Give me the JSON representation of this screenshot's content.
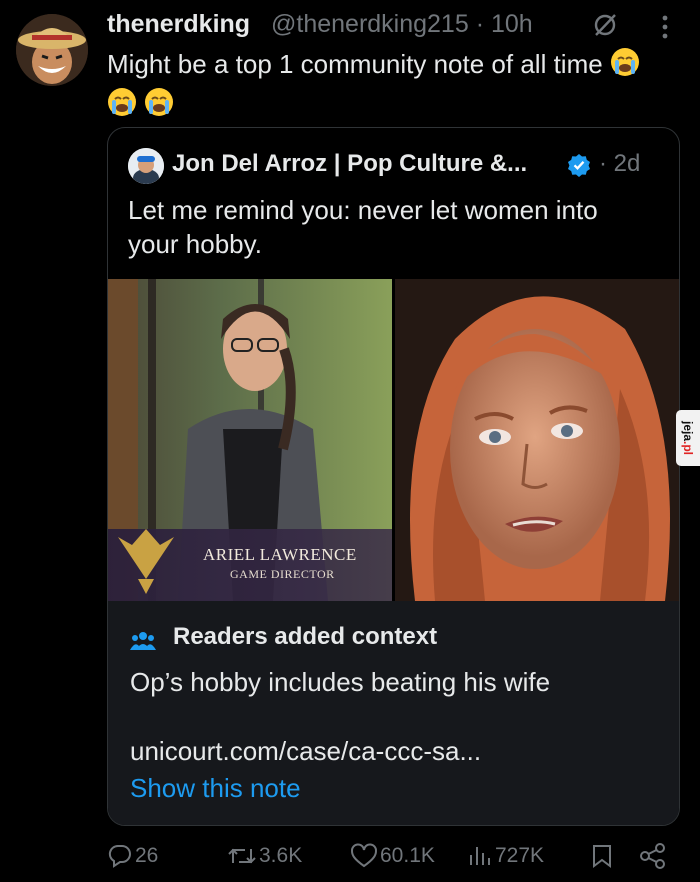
{
  "tweet": {
    "display_name": "thenerdking",
    "handle_time": "@thenerdking215 · 10h",
    "text": "Might be a top 1 community note of all time",
    "emoji_name": "loudly-crying-face"
  },
  "quoted": {
    "display_name": "Jon Del Arroz | Pop Culture &...",
    "time": "· 2d",
    "text": "Let me remind you: never let women into your hobby.",
    "media": {
      "left_caption_name": "ARIEL LAWRENCE",
      "left_caption_role": "GAME DIRECTOR"
    },
    "note": {
      "title": "Readers added context",
      "body": "Op’s hobby includes beating his wife",
      "link": "unicourt.com/case/ca-ccc-sa...",
      "show_label": "Show this note"
    }
  },
  "actions": {
    "replies": "26",
    "reposts": "3.6K",
    "likes": "60.1K",
    "views": "727K"
  },
  "watermark": {
    "brand": "jeja",
    "tld": ".pl"
  },
  "colors": {
    "background": "#000000",
    "text": "#e7e9ea",
    "muted": "#71767b",
    "accent": "#1d9bf0",
    "note_bg": "#16181c"
  }
}
